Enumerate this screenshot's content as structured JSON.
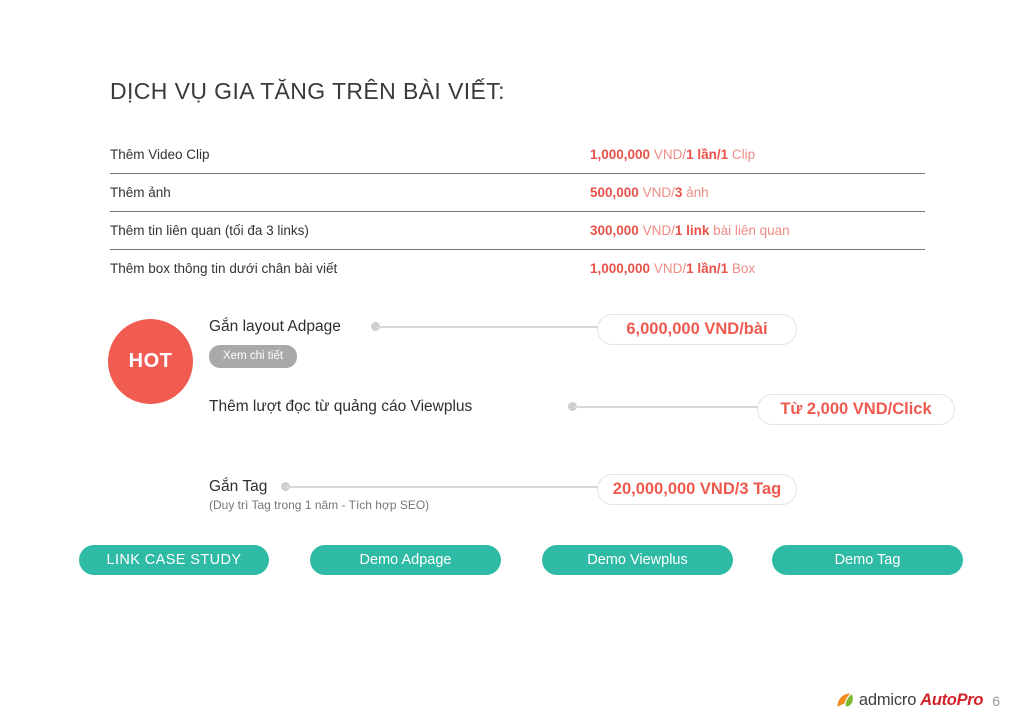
{
  "slide": {
    "title": "DỊCH VỤ GIA TĂNG TRÊN BÀI VIẾT:",
    "page_number": "6",
    "accent_red": "#e8524a",
    "accent_teal": "#2ebaa5",
    "accent_gray": "#a9a9a9"
  },
  "price_table": {
    "rows": [
      {
        "label": "Thêm Video Clip",
        "price_bold_1": "1,000,000",
        "price_light_1": " VND/",
        "price_bold_2": "1 lần/1",
        "price_light_2": " Clip"
      },
      {
        "label": "Thêm ảnh",
        "price_bold_1": "500,000",
        "price_light_1": " VND/",
        "price_bold_2": "3",
        "price_light_2": " ảnh"
      },
      {
        "label": "Thêm tin liên quan (tối đa 3 links)",
        "price_bold_1": "300,000",
        "price_light_1": " VND/",
        "price_bold_2": "1 link",
        "price_light_2": " bài liên quan"
      },
      {
        "label": "Thêm box thông tin dưới chân bài viết",
        "price_bold_1": "1,000,000",
        "price_light_1": " VND/",
        "price_bold_2": "1 lần/1",
        "price_light_2": " Box"
      }
    ]
  },
  "hot_badge": {
    "label": "HOT"
  },
  "features": [
    {
      "title": "Gắn layout Adpage",
      "detail_button": "Xem chi tiết",
      "price": "6,000,000 VND/bài"
    },
    {
      "title": "Thêm lượt đọc từ quảng cáo Viewplus",
      "price": "Từ 2,000 VND/Click"
    },
    {
      "title": "Gắn Tag",
      "subtitle": "(Duy trì Tag trong 1 năm - Tích hợp SEO)",
      "price": "20,000,000 VND/3 Tag"
    }
  ],
  "cta_buttons": [
    {
      "label": "LINK CASE STUDY"
    },
    {
      "label": "Demo Adpage"
    },
    {
      "label": "Demo Viewplus"
    },
    {
      "label": "Demo Tag"
    }
  ],
  "footer": {
    "logo_icon": "leaf-icon",
    "brand_primary": "admicro",
    "brand_secondary": "AutoPro",
    "page_number": "6"
  }
}
